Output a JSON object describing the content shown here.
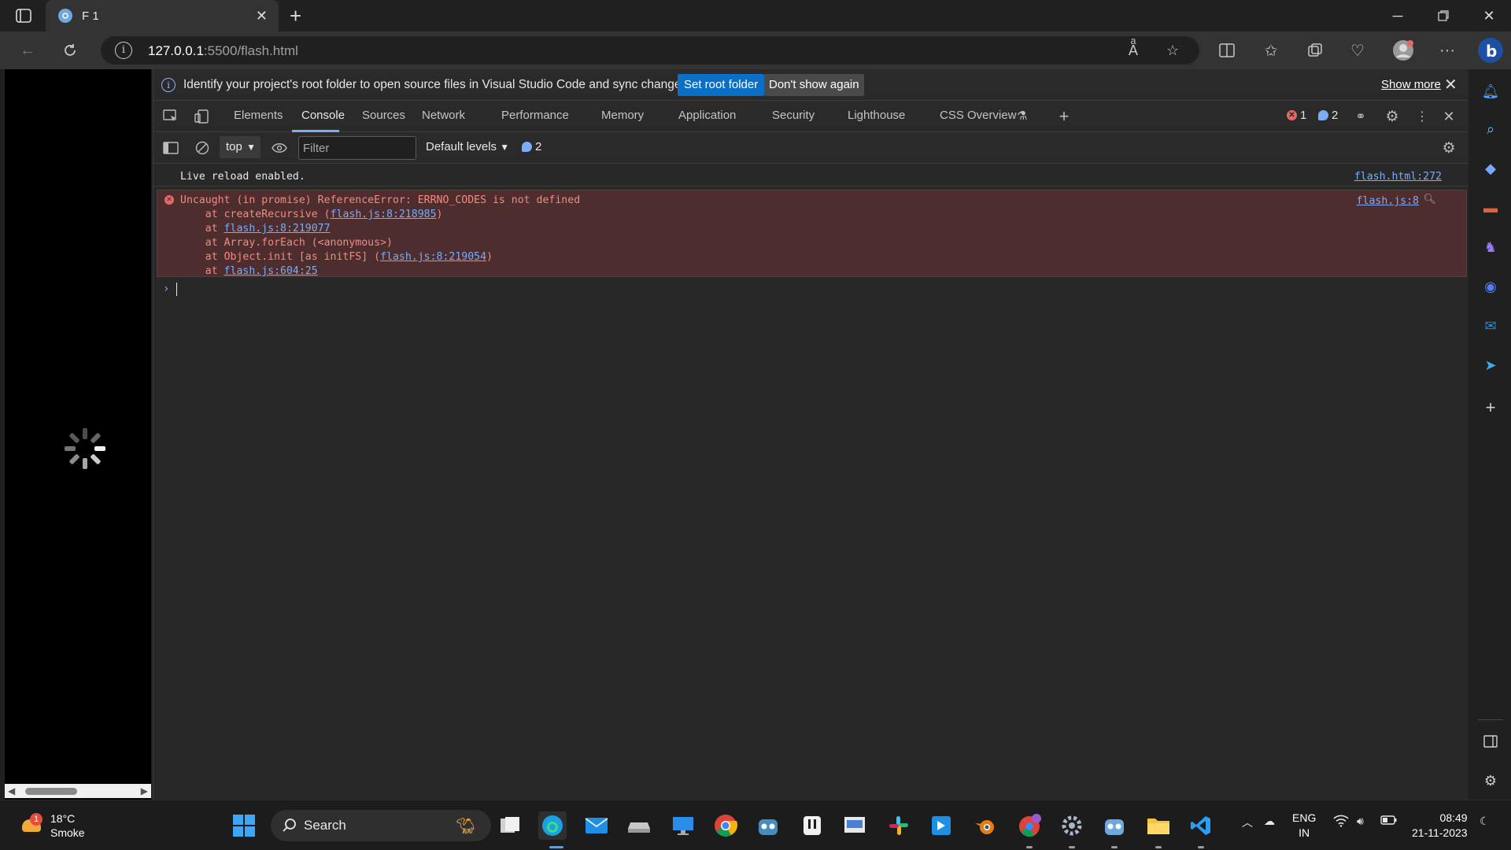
{
  "browser": {
    "tab": {
      "title": "F 1"
    },
    "url": {
      "host": "127.0.0.1",
      "path": ":5500/flash.html"
    }
  },
  "infobar": {
    "message": "Identify your project's root folder to open source files in Visual Studio Code and sync changes.",
    "set_root_label": "Set root folder",
    "dont_show_label": "Don't show again",
    "show_more_label": "Show more"
  },
  "devtools": {
    "tabs": [
      {
        "label": "Elements"
      },
      {
        "label": "Console"
      },
      {
        "label": "Sources"
      },
      {
        "label": "Network"
      },
      {
        "label": "Performance"
      },
      {
        "label": "Memory"
      },
      {
        "label": "Application"
      },
      {
        "label": "Security"
      },
      {
        "label": "Lighthouse"
      },
      {
        "label": "CSS Overview"
      }
    ],
    "error_count": "1",
    "message_count": "2"
  },
  "filterbar": {
    "context": "top",
    "filter_placeholder": "Filter",
    "levels_label": "Default levels",
    "msg_count": "2"
  },
  "console": {
    "log": {
      "text": "Live reload enabled.",
      "source": "flash.html:272"
    },
    "error": {
      "message": "Uncaught (in promise) ReferenceError: ERRNO_CODES is not defined",
      "source": "flash.js:8",
      "stack": [
        {
          "prefix": "    at createRecursive (",
          "link": "flash.js:8:218985",
          "suffix": ")"
        },
        {
          "prefix": "    at ",
          "link": "flash.js:8:219077",
          "suffix": ""
        },
        {
          "prefix": "    at Array.forEach (<anonymous>)",
          "link": "",
          "suffix": ""
        },
        {
          "prefix": "    at Object.init [as initFS] (",
          "link": "flash.js:8:219054",
          "suffix": ")"
        },
        {
          "prefix": "    at ",
          "link": "flash.js:604:25",
          "suffix": ""
        }
      ]
    }
  },
  "taskbar": {
    "weather_temp": "18°C",
    "weather_desc": "Smoke",
    "weather_badge": "1",
    "search_label": "Search",
    "lang_top": "ENG",
    "lang_bottom": "IN",
    "time": "08:49",
    "date": "21-11-2023"
  },
  "colors": {
    "accent": "#7cacf8",
    "error": "#f28b82",
    "error_bg": "#4d2d2d",
    "primary_button": "#0b6fc6"
  }
}
